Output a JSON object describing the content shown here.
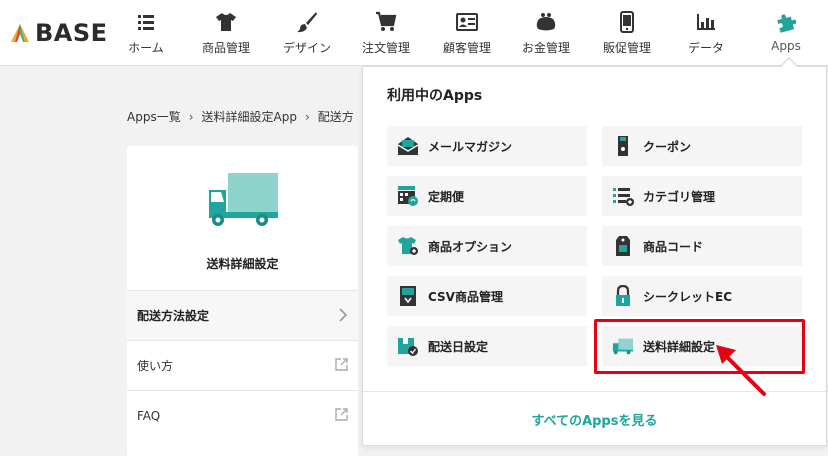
{
  "brand": {
    "name": "BASE",
    "logo_icon": "tent-icon"
  },
  "nav": [
    {
      "label": "ホーム",
      "icon": "list-icon"
    },
    {
      "label": "商品管理",
      "icon": "tshirt-icon"
    },
    {
      "label": "デザイン",
      "icon": "brush-icon"
    },
    {
      "label": "注文管理",
      "icon": "cart-icon"
    },
    {
      "label": "顧客管理",
      "icon": "id-card-icon"
    },
    {
      "label": "お金管理",
      "icon": "purse-icon"
    },
    {
      "label": "販促管理",
      "icon": "phone-icon"
    },
    {
      "label": "データ",
      "icon": "bar-chart-icon"
    },
    {
      "label": "Apps",
      "icon": "puzzle-icon",
      "active": true
    }
  ],
  "breadcrumb": [
    "Apps一覧",
    "送料詳細設定App",
    "配送方"
  ],
  "app_card": {
    "title": "送料詳細設定",
    "menu": [
      {
        "label": "配送方法設定",
        "icon": "chevron-right-icon"
      },
      {
        "label": "使い方",
        "icon": "external-link-icon"
      },
      {
        "label": "FAQ",
        "icon": "external-link-icon"
      }
    ]
  },
  "dropdown": {
    "heading": "利用中のApps",
    "apps": [
      {
        "label": "メールマガジン",
        "icon": "mail-icon"
      },
      {
        "label": "クーポン",
        "icon": "coupon-icon"
      },
      {
        "label": "定期便",
        "icon": "calendar-icon"
      },
      {
        "label": "カテゴリ管理",
        "icon": "category-list-icon"
      },
      {
        "label": "商品オプション",
        "icon": "tshirt-plus-icon"
      },
      {
        "label": "商品コード",
        "icon": "tag-icon"
      },
      {
        "label": "CSV商品管理",
        "icon": "csv-file-icon"
      },
      {
        "label": "シークレットEC",
        "icon": "lock-icon"
      },
      {
        "label": "配送日設定",
        "icon": "box-check-icon"
      },
      {
        "label": "送料詳細設定",
        "icon": "truck-icon"
      }
    ],
    "footer_link": "すべてのAppsを見る"
  },
  "colors": {
    "accent": "#1fa59d",
    "highlight": "#e60012",
    "dark_icon": "#333333"
  }
}
